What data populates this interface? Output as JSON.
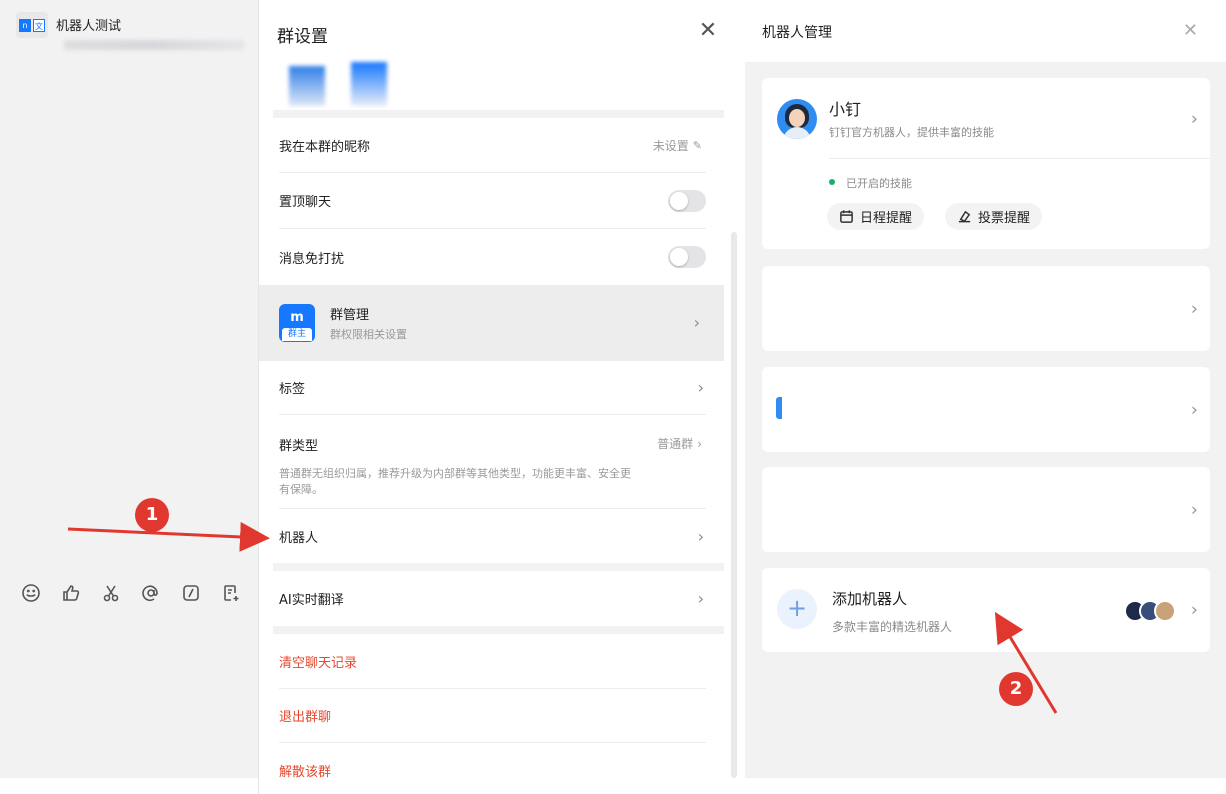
{
  "chat": {
    "title": "机器人测试",
    "avatar_left": "n",
    "avatar_right": "文"
  },
  "toolbar_icons": [
    "emoji-icon",
    "thumbs-up-icon",
    "scissors-icon",
    "at-icon",
    "slash-command-icon",
    "note-add-icon"
  ],
  "group_settings": {
    "title": "群设置",
    "rows": {
      "nickname": {
        "label": "我在本群的昵称",
        "value": "未设置"
      },
      "pin": {
        "label": "置顶聊天",
        "on": false
      },
      "mute": {
        "label": "消息免打扰",
        "on": false
      },
      "manage": {
        "label": "群管理",
        "sub": "群权限相关设置",
        "icon_letter": "m",
        "icon_tag": "群主"
      },
      "tags": {
        "label": "标签"
      },
      "type": {
        "label": "群类型",
        "value": "普通群",
        "desc": "普通群无组织归属，推荐升级为内部群等其他类型，功能更丰富、安全更有保障。"
      },
      "robot": {
        "label": "机器人"
      },
      "ai_translate": {
        "label": "AI实时翻译"
      },
      "clear": {
        "label": "清空聊天记录"
      },
      "exit": {
        "label": "退出群聊"
      },
      "dissolve": {
        "label": "解散该群"
      }
    }
  },
  "robot_management": {
    "title": "机器人管理",
    "xiaoding": {
      "name": "小钉",
      "desc": "钉钉官方机器人，提供丰富的技能",
      "skills_label": "已开启的技能",
      "skills": [
        "日程提醒",
        "投票提醒"
      ]
    },
    "add_robot": {
      "title": "添加机器人",
      "desc": "多款丰富的精选机器人"
    }
  },
  "annotations": {
    "step1": "1",
    "step2": "2"
  },
  "colors": {
    "accent": "#1677ff",
    "danger": "#e5482f",
    "annotation_red": "#e0382f",
    "status_green": "#17b26a"
  }
}
